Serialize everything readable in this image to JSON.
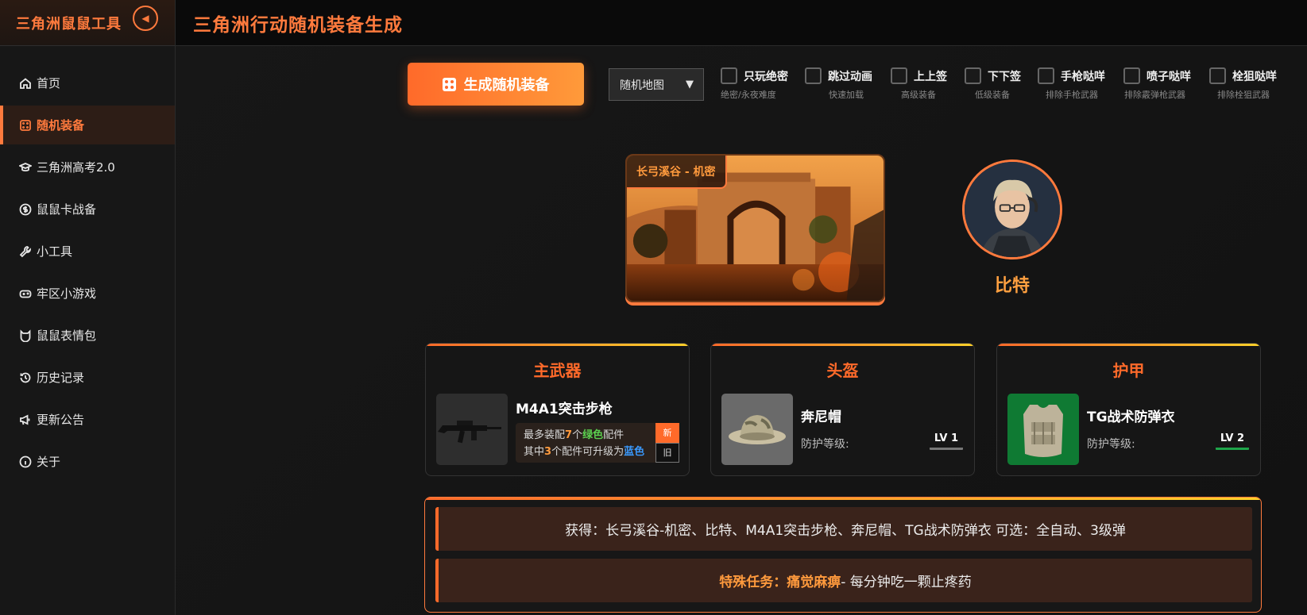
{
  "sidebar": {
    "brand": "三角洲鼠鼠工具",
    "collapse_icon": "◀",
    "items": [
      {
        "label": "首页",
        "icon": "home-icon",
        "active": false
      },
      {
        "label": "随机装备",
        "icon": "dice-grid-icon",
        "active": true
      },
      {
        "label": "三角洲高考2.0",
        "icon": "graduation-cap-icon",
        "active": false
      },
      {
        "label": "鼠鼠卡战备",
        "icon": "coin-icon",
        "active": false
      },
      {
        "label": "小工具",
        "icon": "wrench-icon",
        "active": false
      },
      {
        "label": "牢区小游戏",
        "icon": "gamepad-icon",
        "active": false
      },
      {
        "label": "鼠鼠表情包",
        "icon": "cat-face-icon",
        "active": false
      },
      {
        "label": "历史记录",
        "icon": "history-icon",
        "active": false
      },
      {
        "label": "更新公告",
        "icon": "megaphone-icon",
        "active": false
      },
      {
        "label": "关于",
        "icon": "info-icon",
        "active": false
      }
    ]
  },
  "header": {
    "title": "三角洲行动随机装备生成"
  },
  "controls": {
    "generate_label": "生成随机装备",
    "map_select": "随机地图",
    "map_arrow": "▼",
    "options": [
      {
        "label": "只玩绝密",
        "sub": "绝密/永夜难度",
        "checked": false
      },
      {
        "label": "跳过动画",
        "sub": "快速加载",
        "checked": false
      },
      {
        "label": "上上签",
        "sub": "高级装备",
        "checked": false
      },
      {
        "label": "下下签",
        "sub": "低级装备",
        "checked": false
      },
      {
        "label": "手枪哒咩",
        "sub": "排除手枪武器",
        "checked": false
      },
      {
        "label": "喷子哒咩",
        "sub": "排除霰弹枪武器",
        "checked": false
      },
      {
        "label": "栓狙哒咩",
        "sub": "排除栓狙武器",
        "checked": false
      }
    ]
  },
  "map": {
    "label": "长弓溪谷 - 机密"
  },
  "operator": {
    "name": "比特"
  },
  "cards": {
    "weapon": {
      "title": "主武器",
      "name": "M4A1突击步枪",
      "line1_a": "最多装配",
      "line1_num": "7",
      "line1_b": "个",
      "line1_color": "绿色",
      "line1_c": "配件",
      "line2_a": "其中",
      "line2_num": "3",
      "line2_b": "个配件可升级为",
      "line2_color": "蓝色",
      "tag_new": "新",
      "tag_old": "旧"
    },
    "helmet": {
      "title": "头盔",
      "name": "奔尼帽",
      "prot_label": "防护等级:",
      "level": "LV 1"
    },
    "armor": {
      "title": "护甲",
      "name": "TG战术防弹衣",
      "prot_label": "防护等级:",
      "level": "LV 2"
    }
  },
  "result": {
    "summary": "获得：长弓溪谷-机密、比特、M4A1突击步枪、奔尼帽、TG战术防弹衣 可选：全自动、3级弹",
    "mission_label": "特殊任务：痛觉麻痹",
    "mission_desc": " - 每分钟吃一颗止疼药"
  },
  "colors": {
    "accent": "#ff7a3d",
    "accent_gold": "#ffa040",
    "green": "#5bd14f",
    "blue": "#3a9aff",
    "armor_bg": "#0f7a33"
  }
}
